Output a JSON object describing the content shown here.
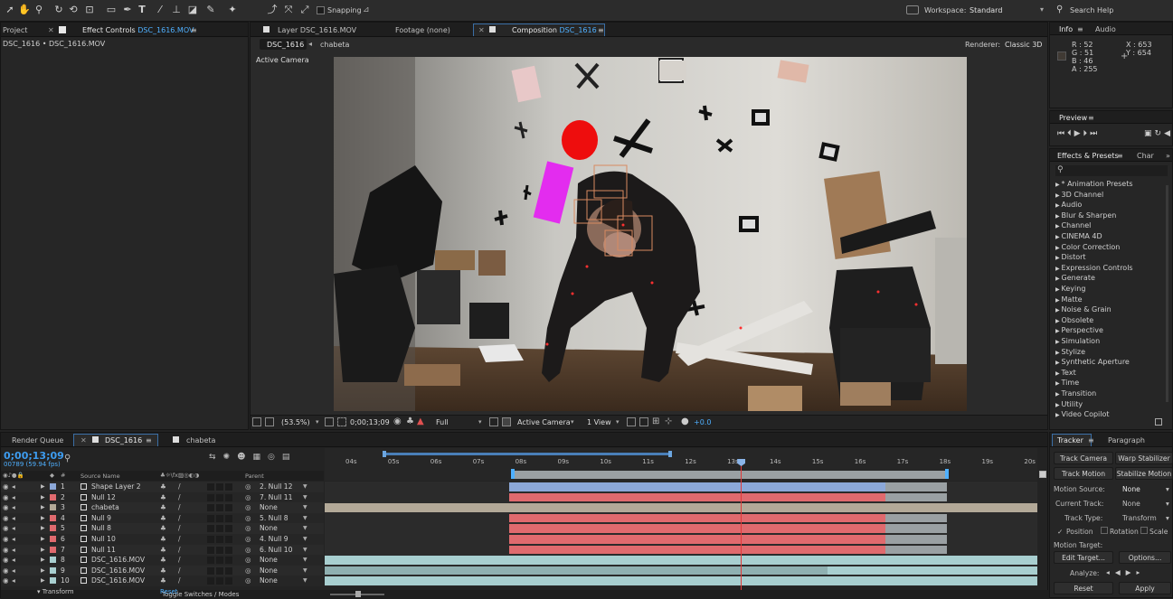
{
  "toolbar": {
    "tool_icons": [
      "selection-icon",
      "hand-icon",
      "zoom-icon",
      "rotate-icon",
      "camera-orbit-icon",
      "pan-behind-icon",
      "rectangle-icon",
      "pen-icon",
      "type-icon",
      "brush-icon",
      "clone-stamp-icon",
      "eraser-icon",
      "roto-brush-icon",
      "puppet-pin-icon"
    ],
    "snapping_label": "Snapping",
    "workspace_label": "Workspace:",
    "workspace_value": "Standard",
    "search_help": "Search Help"
  },
  "left_panel": {
    "tabs": [
      "Project",
      "Effect Controls ",
      "DSC_1616.MOV"
    ],
    "subtitle": "DSC_1616 • DSC_1616.MOV"
  },
  "viewer": {
    "tabs": [
      "Layer DSC_1616.MOV",
      "Footage (none)",
      "Composition ",
      "DSC_1616"
    ],
    "breadcrumb": [
      "DSC_1616",
      "chabeta"
    ],
    "renderer_label": "Renderer:",
    "renderer_value": "Classic 3D",
    "active_camera": "Active Camera",
    "bottom_bar": {
      "zoom": "(53.5%)",
      "timecode": "0;00;13;09",
      "resolution": "Full",
      "camera": "Active Camera",
      "views": "1 View",
      "exposure": "+0.0"
    }
  },
  "info_panel": {
    "tabs": [
      "Info",
      "Audio"
    ],
    "r": "R : 52",
    "g": "G : 51",
    "b": "B : 46",
    "a": "A : 255",
    "x": "X : 653",
    "y": "Y : 654"
  },
  "preview_panel": {
    "title": "Preview"
  },
  "effects_panel": {
    "tabs": [
      "Effects & Presets",
      "Char"
    ],
    "items": [
      "* Animation Presets",
      "3D Channel",
      "Audio",
      "Blur & Sharpen",
      "Channel",
      "CINEMA 4D",
      "Color Correction",
      "Distort",
      "Expression Controls",
      "Generate",
      "Keying",
      "Matte",
      "Noise & Grain",
      "Obsolete",
      "Perspective",
      "Simulation",
      "Stylize",
      "Synthetic Aperture",
      "Text",
      "Time",
      "Transition",
      "Utility",
      "Video Copilot"
    ]
  },
  "timeline": {
    "tabs": [
      "Render Queue",
      "DSC_1616",
      "chabeta"
    ],
    "timecode": "0;00;13;09",
    "frame_info": "00789 (59.94 fps)",
    "col_source": "Source Name",
    "col_parent": "Parent",
    "ruler": [
      "04s",
      "05s",
      "06s",
      "07s",
      "08s",
      "09s",
      "10s",
      "11s",
      "12s",
      "13s",
      "14s",
      "15s",
      "16s",
      "17s",
      "18s",
      "19s",
      "20s"
    ],
    "playhead_seconds": 13.15,
    "layers": [
      {
        "num": "1",
        "name": "Shape Layer 2",
        "parent": "2. Null 12"
      },
      {
        "num": "2",
        "name": "Null 12",
        "parent": "7. Null 11"
      },
      {
        "num": "3",
        "name": "chabeta",
        "parent": "None"
      },
      {
        "num": "4",
        "name": "Null 9",
        "parent": "5. Null 8"
      },
      {
        "num": "5",
        "name": "Null 8",
        "parent": "None"
      },
      {
        "num": "6",
        "name": "Null 10",
        "parent": "4. Null 9"
      },
      {
        "num": "7",
        "name": "Null 11",
        "parent": "6. Null 10"
      },
      {
        "num": "8",
        "name": "DSC_1616.MOV",
        "parent": "None"
      },
      {
        "num": "9",
        "name": "DSC_1616.MOV",
        "parent": "None"
      },
      {
        "num": "10",
        "name": "DSC_1616.MOV",
        "parent": "None"
      }
    ],
    "sublayer": "Transform",
    "sublayer_value": "Reset",
    "footer": "Toggle Switches / Modes",
    "colors": {
      "null_bar": "#e06a6e",
      "shape_bar": "#8ca8d8",
      "footage_bar": "#a8cfd0",
      "work_area": "#9aa0a3",
      "tan_bar": "#b3a998"
    }
  },
  "tracker": {
    "tabs": [
      "Tracker",
      "Paragraph"
    ],
    "track_camera": "Track Camera",
    "warp_stabilizer": "Warp Stabilizer",
    "track_motion": "Track Motion",
    "stabilize_motion": "Stabilize Motion",
    "motion_source_label": "Motion Source:",
    "motion_source_value": "None",
    "current_track_label": "Current Track:",
    "current_track_value": "None",
    "track_type_label": "Track Type:",
    "track_type_value": "Transform",
    "position": "Position",
    "rotation": "Rotation",
    "scale": "Scale",
    "motion_target": "Motion Target:",
    "edit_target": "Edit Target...",
    "options": "Options...",
    "analyze": "Analyze:",
    "reset": "Reset",
    "apply": "Apply"
  }
}
